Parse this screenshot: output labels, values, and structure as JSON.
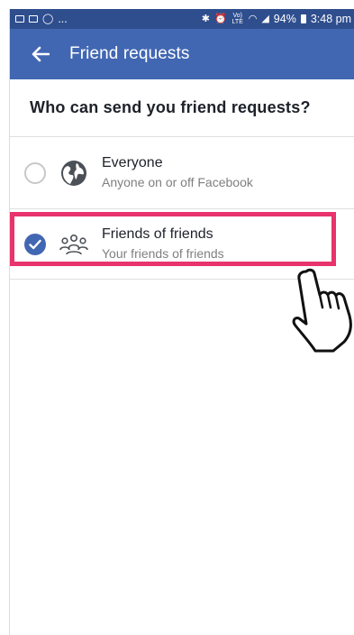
{
  "status_bar": {
    "left_text": "...",
    "battery": "94%",
    "time": "3:48 pm",
    "network_label": "Vo) LTE"
  },
  "app_bar": {
    "title": "Friend requests",
    "back_icon": "back-arrow-icon",
    "color": "#4267b2"
  },
  "question": "Who can send you friend requests?",
  "options": [
    {
      "title": "Everyone",
      "subtitle": "Anyone on or off Facebook",
      "icon": "globe-icon",
      "selected": false
    },
    {
      "title": "Friends of friends",
      "subtitle": "Your friends of friends",
      "icon": "friends-group-icon",
      "selected": true
    }
  ],
  "highlight_color": "#e8336d",
  "overlay": {
    "icon": "pointing-hand-cursor-icon"
  }
}
